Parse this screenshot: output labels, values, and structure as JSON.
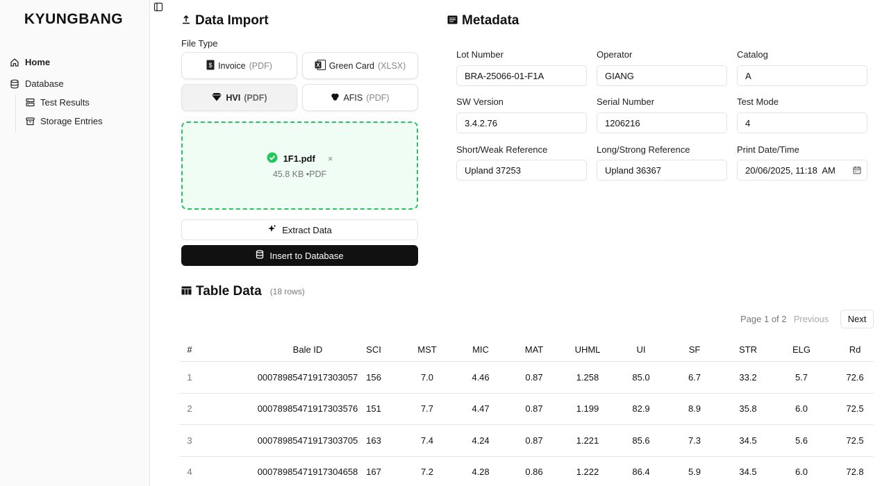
{
  "sidebar": {
    "brand": "KYUNGBANG",
    "items": [
      {
        "label": "Home"
      },
      {
        "label": "Database"
      }
    ],
    "subitems": [
      {
        "label": "Test Results"
      },
      {
        "label": "Storage Entries"
      }
    ]
  },
  "import": {
    "title": "Data Import",
    "file_type_label": "File Type",
    "file_types": [
      {
        "name": "Invoice",
        "ext": "(PDF)"
      },
      {
        "name": "Green Card",
        "ext": "(XLSX)"
      },
      {
        "name": "HVI",
        "ext": "(PDF)"
      },
      {
        "name": "AFIS",
        "ext": "(PDF)"
      }
    ],
    "file": {
      "name": "1F1.pdf",
      "meta": "45.8 KB •PDF",
      "remove": "×"
    },
    "extract_label": "Extract Data",
    "insert_label": "Insert to Database"
  },
  "metadata": {
    "title": "Metadata",
    "fields": [
      {
        "label": "Lot Number",
        "value": "BRA-25066-01-F1A"
      },
      {
        "label": "Operator",
        "value": "GIANG"
      },
      {
        "label": "Catalog",
        "value": "A"
      },
      {
        "label": "SW Version",
        "value": "3.4.2.76"
      },
      {
        "label": "Serial Number",
        "value": "1206216"
      },
      {
        "label": "Test Mode",
        "value": "4"
      },
      {
        "label": "Short/Weak Reference",
        "value": "Upland 37253"
      },
      {
        "label": "Long/Strong Reference",
        "value": "Upland 36367"
      },
      {
        "label": "Print Date/Time",
        "value": "20/06/2025, 11:18  AM"
      }
    ]
  },
  "table": {
    "title": "Table Data",
    "rows_note": "(18 rows)",
    "page_info": "Page 1 of 2",
    "prev_label": "Previous",
    "next_label": "Next",
    "columns": [
      "#",
      "Bale ID",
      "SCI",
      "MST",
      "MIC",
      "MAT",
      "UHML",
      "UI",
      "SF",
      "STR",
      "ELG",
      "Rd"
    ],
    "rows": [
      [
        "1",
        "00078985471917303057",
        "156",
        "7.0",
        "4.46",
        "0.87",
        "1.258",
        "85.0",
        "6.7",
        "33.2",
        "5.7",
        "72.6"
      ],
      [
        "2",
        "00078985471917303576",
        "151",
        "7.7",
        "4.47",
        "0.87",
        "1.199",
        "82.9",
        "8.9",
        "35.8",
        "6.0",
        "72.5"
      ],
      [
        "3",
        "00078985471917303705",
        "163",
        "7.4",
        "4.24",
        "0.87",
        "1.221",
        "85.6",
        "7.3",
        "34.5",
        "5.6",
        "72.5"
      ],
      [
        "4",
        "00078985471917304658",
        "167",
        "7.2",
        "4.28",
        "0.86",
        "1.222",
        "86.4",
        "5.9",
        "34.5",
        "6.0",
        "72.8"
      ]
    ]
  },
  "colors": {
    "accent_green": "#22c55e",
    "dark_button": "#111111"
  }
}
